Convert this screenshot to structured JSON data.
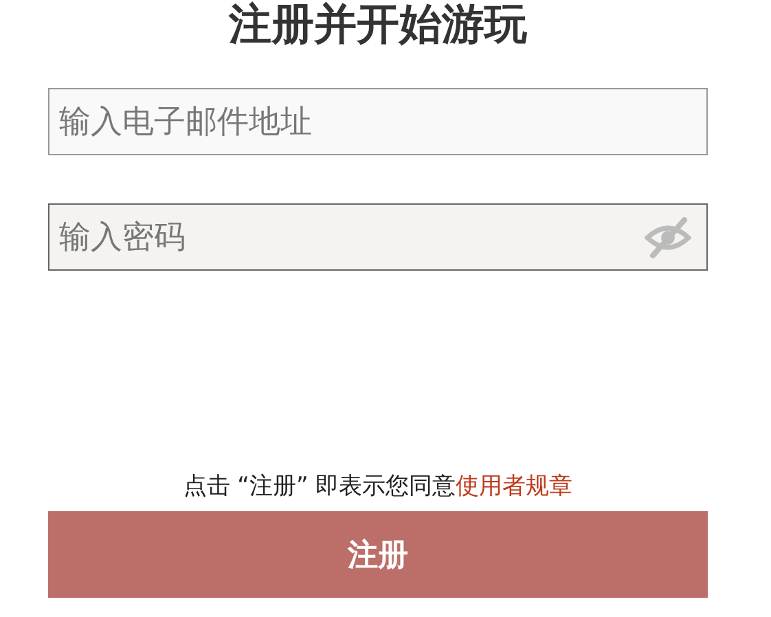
{
  "title": "注册并开始游玩",
  "fields": [
    {
      "kind": "email",
      "placeholder": "输入电子邮件地址"
    },
    {
      "kind": "password",
      "placeholder": "输入密码",
      "password_visible": false
    }
  ],
  "agreement": {
    "text": "点击 “注册” 即表示您同意",
    "link": "使用者规章"
  },
  "submit_button": "注册"
}
